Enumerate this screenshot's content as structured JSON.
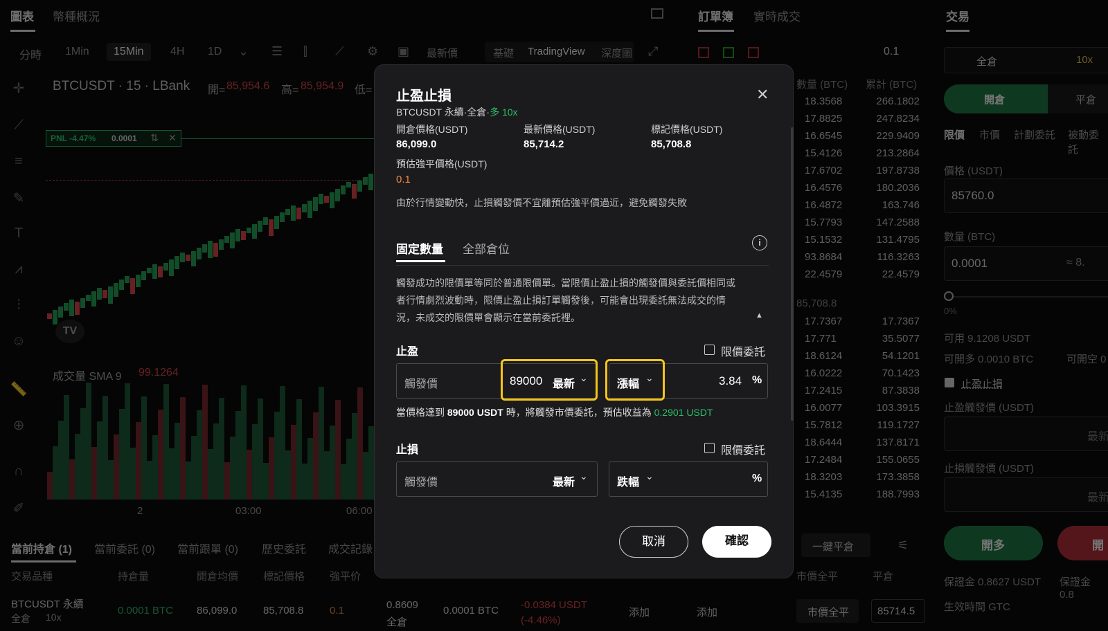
{
  "top_tabs": {
    "chart": "圖表",
    "overview": "幣種概況",
    "orderbook": "訂單簿",
    "trades": "實時成交",
    "trade": "交易"
  },
  "timeframes": [
    "分時",
    "1Min",
    "15Min",
    "4H",
    "1D"
  ],
  "toolbar": {
    "price_type": "最新價",
    "basic": "基礎",
    "tradingview": "TradingView",
    "depth": "深度圖",
    "qty_step": "0.1"
  },
  "chart": {
    "title": "BTCUSDT · 15 · LBank",
    "open_label": "開=",
    "open": "85,954.6",
    "high_label": "高=",
    "high": "85,954.9",
    "low_label": "低=",
    "pnl": "PNL -4.47%",
    "pnl_qty": "0.0001",
    "volume_label": "成交量 SMA 9",
    "volume_value": "99.1264",
    "x_ticks": [
      "2",
      "03:00",
      "06:00"
    ],
    "candle_up": "#26a65b",
    "candle_down": "#e0474c"
  },
  "orderbook": {
    "col_qty": "數量 (BTC)",
    "col_cum": "累計 (BTC)",
    "asks": [
      [
        "18.3568",
        "266.1802"
      ],
      [
        "17.8825",
        "247.8234"
      ],
      [
        "16.6545",
        "229.9409"
      ],
      [
        "15.4126",
        "213.2864"
      ],
      [
        "17.6702",
        "197.8738"
      ],
      [
        "16.4576",
        "180.2036"
      ],
      [
        "16.4872",
        "163.746"
      ],
      [
        "15.7793",
        "147.2588"
      ],
      [
        "15.1532",
        "131.4795"
      ],
      [
        "93.8684",
        "116.3263"
      ],
      [
        "22.4579",
        "22.4579"
      ]
    ],
    "mid": "85,708.8",
    "bids": [
      [
        "17.7367",
        "17.7367"
      ],
      [
        "17.771",
        "35.5077"
      ],
      [
        "18.6124",
        "54.1201"
      ],
      [
        "16.0222",
        "70.1423"
      ],
      [
        "17.2415",
        "87.3838"
      ],
      [
        "16.0077",
        "103.3915"
      ],
      [
        "15.7812",
        "119.1727"
      ],
      [
        "18.6444",
        "137.8171"
      ],
      [
        "17.2484",
        "155.0655"
      ],
      [
        "18.3203",
        "173.3858"
      ],
      [
        "15.4135",
        "188.7993"
      ]
    ]
  },
  "trade_panel": {
    "margin_mode": "全倉",
    "leverage": "10x",
    "open": "開倉",
    "close": "平倉",
    "tabs": [
      "限價",
      "市價",
      "計劃委託",
      "被動委託"
    ],
    "price_label": "價格 (USDT)",
    "price": "85760.0",
    "qty_label": "數量 (BTC)",
    "qty": "0.0001",
    "qty_approx": "≈ 8.",
    "pct": "0%",
    "avail": "可用 9.1208 USDT",
    "can_long": "可開多 0.0010 BTC",
    "can_short": "可開空 0",
    "tpsl": "止盈止損",
    "tp_trigger": "止盈觸發價 (USDT)",
    "sl_trigger": "止損觸發價 (USDT)",
    "latest": "最新",
    "buy_long": "開多",
    "sell_short": "開",
    "margin1": "保證金 0.8627 USDT",
    "margin2": "保證金 0.8",
    "effective": "生效時間 GTC"
  },
  "bottom": {
    "tabs": [
      "當前持倉 (1)",
      "當前委託 (0)",
      "當前跟單 (0)",
      "歷史委託",
      "成交記錄"
    ],
    "close_all": "一鍵平倉",
    "headers": [
      "交易品種",
      "持倉量",
      "開倉均價",
      "標記價格",
      "強平价"
    ],
    "right_headers": [
      "市價全平",
      "平倉"
    ],
    "row": {
      "symbol": "BTCUSDT 永續",
      "mode": "全倉",
      "lev": "10x",
      "qty": "0.0001 BTC",
      "entry": "86,099.0",
      "mark": "85,708.8",
      "liq": "0.1",
      "margin": "0.8609",
      "margin_mode": "全倉",
      "size": "0.0001 BTC",
      "pnl": "-0.0384 USDT",
      "pnl_pct": "(-4.46%)",
      "add1": "添加",
      "add2": "添加",
      "market_close": "市價全平",
      "close_price": "85714.5"
    }
  },
  "modal": {
    "title": "止盈止損",
    "subtitle": "BTCUSDT 永續·全倉·",
    "side": "多 10x",
    "open_price_label": "開倉價格(USDT)",
    "open_price": "86,099.0",
    "last_price_label": "最新價格(USDT)",
    "last_price": "85,714.2",
    "mark_price_label": "標記價格(USDT)",
    "mark_price": "85,708.8",
    "liq_label": "預估強平價格(USDT)",
    "liq_price": "0.1",
    "warning": "由於行情變動快，止損觸發價不宜離預估強平價過近，避免觸發失敗",
    "tab_fixed": "固定數量",
    "tab_all": "全部倉位",
    "info1": "觸發成功的限價單等同於普通限價單。當限價止盈止損的觸發價與委託價相同或",
    "info2": "者行情劇烈波動時，限價止盈止損訂單觸發後，可能會出現委託無法成交的情",
    "info3": "況，未成交的限價單會顯示在當前委託裡。",
    "tp_label": "止盈",
    "limit_order": "限價委託",
    "trigger_label": "觸發價",
    "tp_value": "89000",
    "price_source": "最新",
    "tp_mode": "漲幅",
    "tp_pct": "3.84",
    "pct_sign": "%",
    "tp_note_a": "當價格達到 ",
    "tp_note_price": "89000 USDT",
    "tp_note_b": " 時，將觸發市價委託，預估收益為 ",
    "tp_note_profit": "0.2901 USDT",
    "sl_label": "止損",
    "sl_mode": "跌幅",
    "cancel": "取消",
    "confirm": "確認",
    "accent_green": "#2ebd6b",
    "accent_orange": "#f0883e",
    "highlight": "#f5c518"
  }
}
